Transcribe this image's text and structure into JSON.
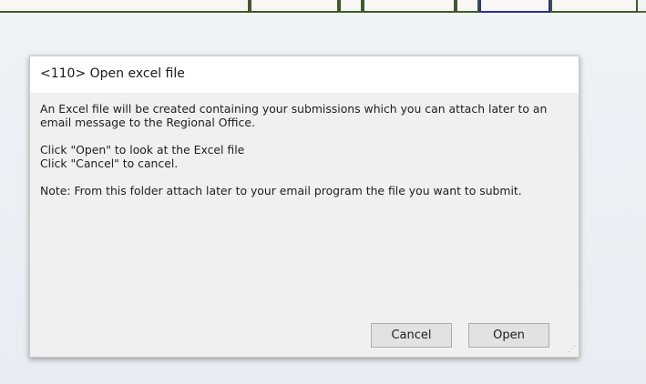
{
  "dialog": {
    "title": "<110> Open excel file",
    "message_line1": "An Excel file will be created containing your submissions which you can attach later to an email message to the Regional Office.",
    "message_line2a": "Click \"Open\" to look at the Excel file",
    "message_line2b": "Click \"Cancel\" to cancel.",
    "message_line3": "Note: From this folder attach later to your email program the file you want to submit.",
    "cancel_label": "Cancel",
    "open_label": "Open"
  },
  "icons": {
    "resize_grip": "resize-grip-icon"
  }
}
